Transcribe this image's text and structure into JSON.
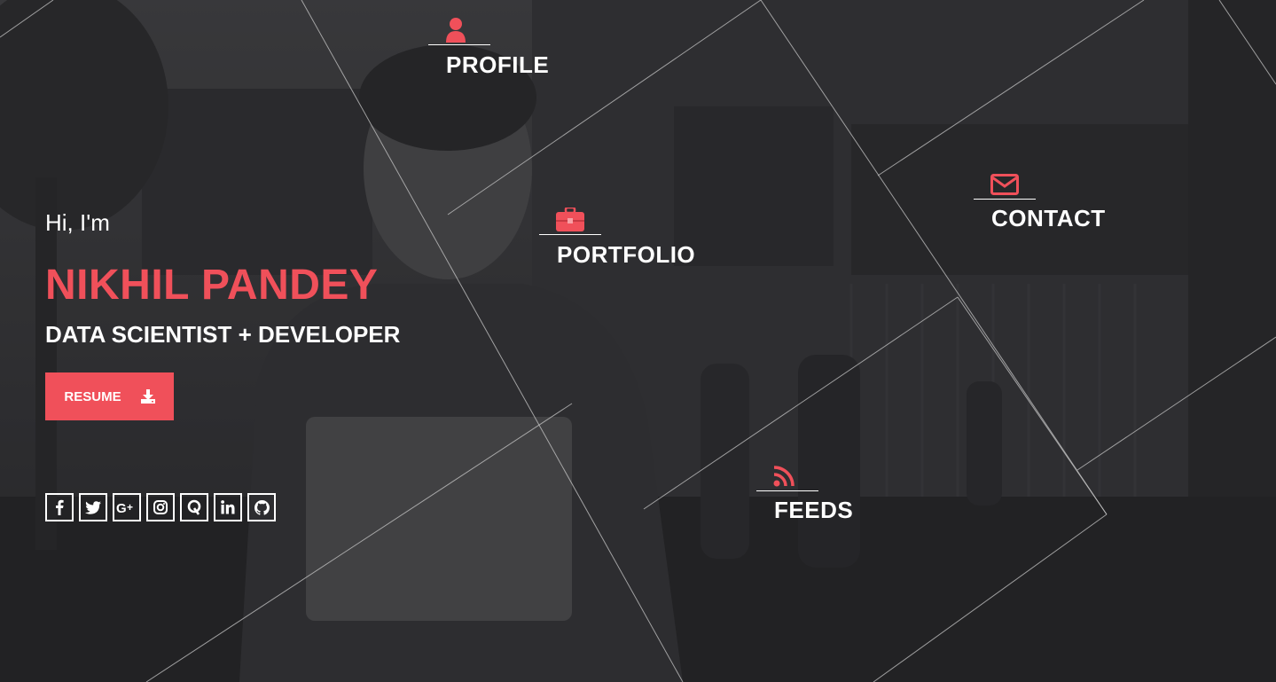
{
  "nav": {
    "profile": "PROFILE",
    "portfolio": "PORTFOLIO",
    "contact": "CONTACT",
    "feeds": "FEEDS"
  },
  "intro": {
    "greeting": "Hi, I'm",
    "name": "NIKHIL PANDEY",
    "role": "DATA SCIENTIST + DEVELOPER",
    "resume_label": "RESUME"
  },
  "social": [
    {
      "icon": "facebook-icon",
      "glyph": "f"
    },
    {
      "icon": "twitter-icon",
      "glyph": "t"
    },
    {
      "icon": "google-plus-icon",
      "glyph": "G+"
    },
    {
      "icon": "instagram-icon",
      "glyph": "ig"
    },
    {
      "icon": "quora-icon",
      "glyph": "Q"
    },
    {
      "icon": "linkedin-icon",
      "glyph": "in"
    },
    {
      "icon": "github-icon",
      "glyph": "gh"
    }
  ],
  "colors": {
    "accent": "#f0505a",
    "text": "#ffffff",
    "background": "#2a2a2d"
  }
}
